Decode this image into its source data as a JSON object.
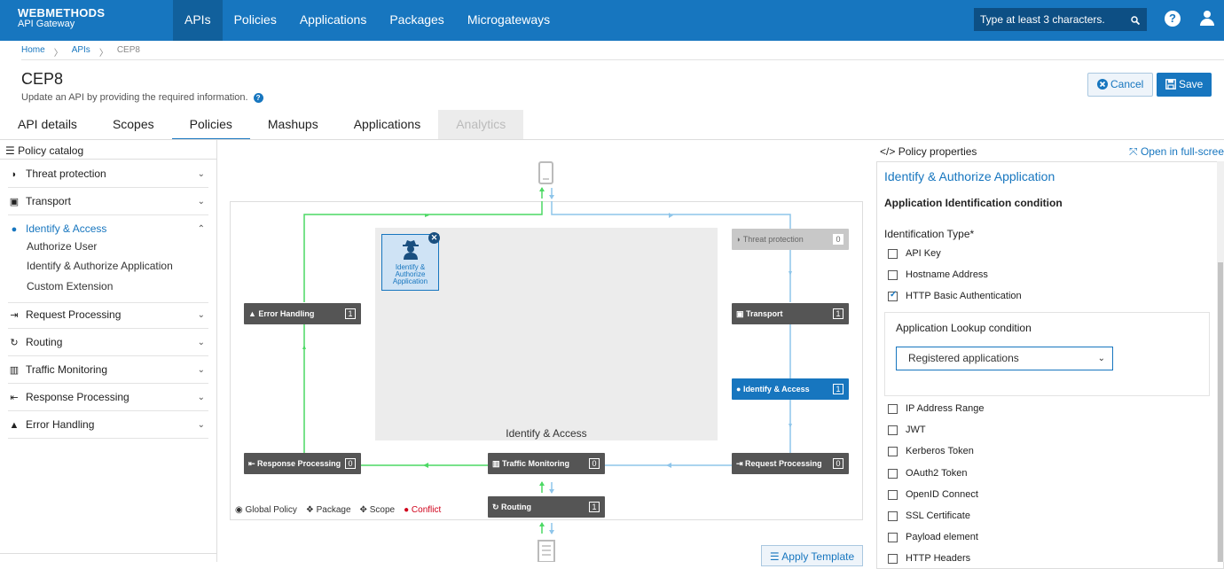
{
  "brand": {
    "line1": "WEBMETHODS",
    "line2": "API Gateway"
  },
  "nav": [
    "APIs",
    "Policies",
    "Applications",
    "Packages",
    "Microgateways"
  ],
  "search": {
    "placeholder": "Type at least 3 characters."
  },
  "help_label": "?",
  "breadcrumb": {
    "home": "Home",
    "apis": "APIs",
    "current": "CEP8",
    "sep": "〉"
  },
  "page": {
    "title": "CEP8",
    "subtitle": "Update an API by providing the required information."
  },
  "buttons": {
    "cancel": "Cancel",
    "save": "Save",
    "apply_template": "Apply Template"
  },
  "tabs": [
    "API details",
    "Scopes",
    "Policies",
    "Mashups",
    "Applications",
    "Analytics"
  ],
  "catalog": {
    "title": "Policy catalog",
    "categories": [
      "Threat protection",
      "Transport",
      "Identify & Access",
      "Request Processing",
      "Routing",
      "Traffic Monitoring",
      "Response Processing",
      "Error Handling"
    ],
    "subitems": [
      "Authorize User",
      "Identify & Authorize Application",
      "Custom Extension"
    ]
  },
  "canvas": {
    "drop_label": "Identify & Access",
    "policy_card": [
      "Identify &",
      "Authorize",
      "Application"
    ],
    "stages": {
      "threat": {
        "label": "Threat protection",
        "count": "0"
      },
      "error": {
        "label": "Error Handling",
        "count": "1"
      },
      "transport": {
        "label": "Transport",
        "count": "1"
      },
      "identify": {
        "label": "Identify & Access",
        "count": "1"
      },
      "response": {
        "label": "Response Processing",
        "count": "0"
      },
      "traffic": {
        "label": "Traffic Monitoring",
        "count": "0"
      },
      "request": {
        "label": "Request Processing",
        "count": "0"
      },
      "routing": {
        "label": "Routing",
        "count": "1"
      }
    },
    "legend": {
      "global": "Global Policy",
      "package": "Package",
      "scope": "Scope",
      "conflict": "Conflict"
    }
  },
  "properties": {
    "head": "Policy properties",
    "fullscreen": "Open in full-screen",
    "title": "Identify & Authorize Application",
    "section": "Application Identification condition",
    "id_type": "Identification Type*",
    "options_top": [
      {
        "label": "API Key",
        "checked": false
      },
      {
        "label": "Hostname Address",
        "checked": false
      },
      {
        "label": "HTTP Basic Authentication",
        "checked": true
      }
    ],
    "lookup_title": "Application Lookup condition",
    "lookup_value": "Registered applications",
    "options_bottom": [
      {
        "label": "IP Address Range",
        "checked": false
      },
      {
        "label": "JWT",
        "checked": false
      },
      {
        "label": "Kerberos Token",
        "checked": false
      },
      {
        "label": "OAuth2 Token",
        "checked": false
      },
      {
        "label": "OpenID Connect",
        "checked": false
      },
      {
        "label": "SSL Certificate",
        "checked": false
      },
      {
        "label": "Payload element",
        "checked": false
      },
      {
        "label": "HTTP Headers",
        "checked": false
      }
    ]
  },
  "colors": {
    "accent": "#1776bf",
    "flow_green": "#4cd964",
    "flow_blue": "#8ec5ea",
    "conflict": "#d0021b"
  }
}
